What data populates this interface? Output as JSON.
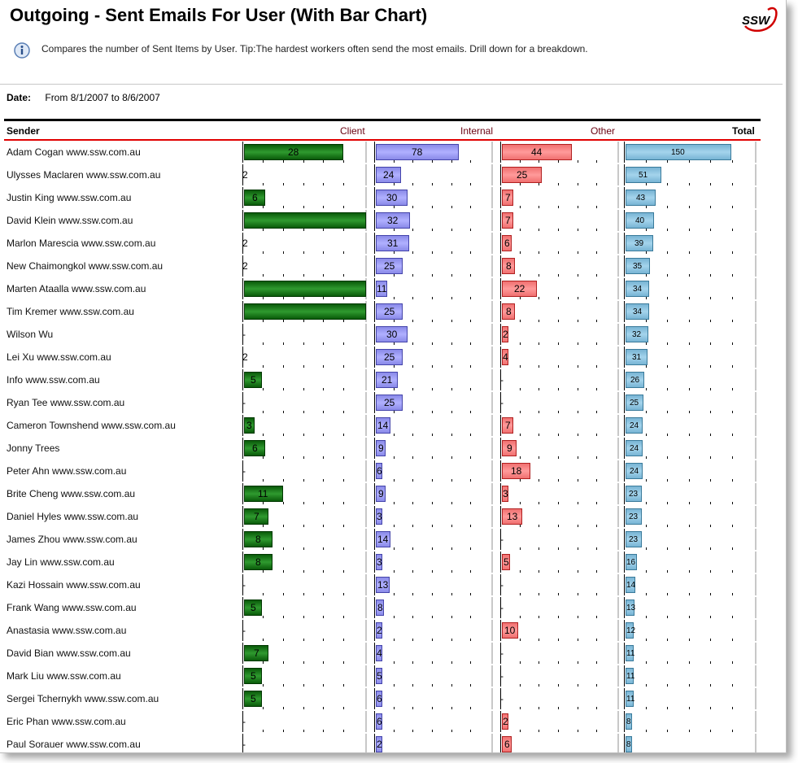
{
  "header": {
    "title": "Outgoing - Sent Emails For User (With Bar Chart)",
    "logo_text": "SSW",
    "description": "Compares the number of Sent Items by User. Tip:The hardest workers often send the most emails. Drill down for a breakdown."
  },
  "date": {
    "label": "Date:",
    "value": "From 8/1/2007 to 8/6/2007"
  },
  "columns": {
    "sender": "Sender",
    "client": "Client",
    "internal": "Internal",
    "other": "Other",
    "total": "Total"
  },
  "colors": {
    "client": "#1f7a1f",
    "internal": "#9a9af5",
    "other": "#f58080",
    "total": "#8cc4e0",
    "header_rule": "#e00000"
  },
  "rows": [
    {
      "sender": "Adam Cogan www.ssw.com.au",
      "client": {
        "label": "28",
        "value": 28
      },
      "internal": {
        "label": "78",
        "value": 78
      },
      "other": {
        "label": "44",
        "value": 44
      },
      "total": {
        "label": "150",
        "value": 150
      }
    },
    {
      "sender": "Ulysses Maclaren www.ssw.com.au",
      "client": {
        "label": "2",
        "value": 0
      },
      "internal": {
        "label": "24",
        "value": 24
      },
      "other": {
        "label": "25",
        "value": 25
      },
      "total": {
        "label": "51",
        "value": 51
      }
    },
    {
      "sender": "Justin King www.ssw.com.au",
      "client": {
        "label": "6",
        "value": 6
      },
      "internal": {
        "label": "30",
        "value": 30
      },
      "other": {
        "label": "7",
        "value": 7
      },
      "total": {
        "label": "43",
        "value": 43
      }
    },
    {
      "sender": "David Klein www.ssw.com.au",
      "client": {
        "label": "",
        "value": 35
      },
      "internal": {
        "label": "32",
        "value": 32
      },
      "other": {
        "label": "7",
        "value": 7
      },
      "total": {
        "label": "40",
        "value": 40
      }
    },
    {
      "sender": "Marlon Marescia www.ssw.com.au",
      "client": {
        "label": "2",
        "value": 0
      },
      "internal": {
        "label": "31",
        "value": 31
      },
      "other": {
        "label": "6",
        "value": 6
      },
      "total": {
        "label": "39",
        "value": 39
      }
    },
    {
      "sender": "New Chaimongkol www.ssw.com.au",
      "client": {
        "label": "2",
        "value": 0
      },
      "internal": {
        "label": "25",
        "value": 25
      },
      "other": {
        "label": "8",
        "value": 8
      },
      "total": {
        "label": "35",
        "value": 35
      }
    },
    {
      "sender": "Marten Ataalla www.ssw.com.au",
      "client": {
        "label": "",
        "value": 35
      },
      "internal": {
        "label": "11",
        "value": 11
      },
      "other": {
        "label": "22",
        "value": 22
      },
      "total": {
        "label": "34",
        "value": 34
      }
    },
    {
      "sender": "Tim Kremer www.ssw.com.au",
      "client": {
        "label": "",
        "value": 35
      },
      "internal": {
        "label": "25",
        "value": 25
      },
      "other": {
        "label": "8",
        "value": 8
      },
      "total": {
        "label": "34",
        "value": 34
      }
    },
    {
      "sender": "Wilson Wu",
      "client": {
        "label": "-",
        "value": 0
      },
      "internal": {
        "label": "30",
        "value": 30
      },
      "other": {
        "label": "2",
        "value": 2
      },
      "total": {
        "label": "32",
        "value": 32
      }
    },
    {
      "sender": "Lei Xu www.ssw.com.au",
      "client": {
        "label": "2",
        "value": 0
      },
      "internal": {
        "label": "25",
        "value": 25
      },
      "other": {
        "label": "4",
        "value": 4
      },
      "total": {
        "label": "31",
        "value": 31
      }
    },
    {
      "sender": "Info www.ssw.com.au",
      "client": {
        "label": "5",
        "value": 5
      },
      "internal": {
        "label": "21",
        "value": 21
      },
      "other": {
        "label": "-",
        "value": 0
      },
      "total": {
        "label": "26",
        "value": 26
      }
    },
    {
      "sender": "Ryan Tee www.ssw.com.au",
      "client": {
        "label": "-",
        "value": 0
      },
      "internal": {
        "label": "25",
        "value": 25
      },
      "other": {
        "label": "-",
        "value": 0
      },
      "total": {
        "label": "25",
        "value": 25
      }
    },
    {
      "sender": "Cameron Townshend www.ssw.com.au",
      "client": {
        "label": "3",
        "value": 3
      },
      "internal": {
        "label": "14",
        "value": 14
      },
      "other": {
        "label": "7",
        "value": 7
      },
      "total": {
        "label": "24",
        "value": 24
      }
    },
    {
      "sender": "Jonny Trees",
      "client": {
        "label": "6",
        "value": 6
      },
      "internal": {
        "label": "9",
        "value": 9
      },
      "other": {
        "label": "9",
        "value": 9
      },
      "total": {
        "label": "24",
        "value": 24
      }
    },
    {
      "sender": "Peter Ahn www.ssw.com.au",
      "client": {
        "label": "-",
        "value": 0
      },
      "internal": {
        "label": "6",
        "value": 6
      },
      "other": {
        "label": "18",
        "value": 18
      },
      "total": {
        "label": "24",
        "value": 24
      }
    },
    {
      "sender": "Brite Cheng www.ssw.com.au",
      "client": {
        "label": "11",
        "value": 11
      },
      "internal": {
        "label": "9",
        "value": 9
      },
      "other": {
        "label": "3",
        "value": 3
      },
      "total": {
        "label": "23",
        "value": 23
      }
    },
    {
      "sender": "Daniel Hyles www.ssw.com.au",
      "client": {
        "label": "7",
        "value": 7
      },
      "internal": {
        "label": "3",
        "value": 3
      },
      "other": {
        "label": "13",
        "value": 13
      },
      "total": {
        "label": "23",
        "value": 23
      }
    },
    {
      "sender": "James Zhou www.ssw.com.au",
      "client": {
        "label": "8",
        "value": 8
      },
      "internal": {
        "label": "14",
        "value": 14
      },
      "other": {
        "label": "-",
        "value": 0
      },
      "total": {
        "label": "23",
        "value": 23
      }
    },
    {
      "sender": "Jay Lin www.ssw.com.au",
      "client": {
        "label": "8",
        "value": 8
      },
      "internal": {
        "label": "3",
        "value": 3
      },
      "other": {
        "label": "5",
        "value": 5
      },
      "total": {
        "label": "16",
        "value": 16
      }
    },
    {
      "sender": "Kazi Hossain www.ssw.com.au",
      "client": {
        "label": "-",
        "value": 0
      },
      "internal": {
        "label": "13",
        "value": 13
      },
      "other": {
        "label": "-",
        "value": 0
      },
      "total": {
        "label": "14",
        "value": 14
      }
    },
    {
      "sender": "Frank Wang www.ssw.com.au",
      "client": {
        "label": "5",
        "value": 5
      },
      "internal": {
        "label": "8",
        "value": 8
      },
      "other": {
        "label": "-",
        "value": 0
      },
      "total": {
        "label": "13",
        "value": 13
      }
    },
    {
      "sender": "Anastasia www.ssw.com.au",
      "client": {
        "label": "-",
        "value": 0
      },
      "internal": {
        "label": "2",
        "value": 2
      },
      "other": {
        "label": "10",
        "value": 10
      },
      "total": {
        "label": "12",
        "value": 12
      }
    },
    {
      "sender": "David Bian www.ssw.com.au",
      "client": {
        "label": "7",
        "value": 7
      },
      "internal": {
        "label": "4",
        "value": 4
      },
      "other": {
        "label": "-",
        "value": 0
      },
      "total": {
        "label": "11",
        "value": 11
      }
    },
    {
      "sender": "Mark Liu www.ssw.com.au",
      "client": {
        "label": "5",
        "value": 5
      },
      "internal": {
        "label": "5",
        "value": 5
      },
      "other": {
        "label": "-",
        "value": 0
      },
      "total": {
        "label": "11",
        "value": 11
      }
    },
    {
      "sender": "Sergei Tchernykh www.ssw.com.au",
      "client": {
        "label": "5",
        "value": 5
      },
      "internal": {
        "label": "6",
        "value": 6
      },
      "other": {
        "label": "-",
        "value": 0
      },
      "total": {
        "label": "11",
        "value": 11
      }
    },
    {
      "sender": "Eric Phan www.ssw.com.au",
      "client": {
        "label": "-",
        "value": 0
      },
      "internal": {
        "label": "6",
        "value": 6
      },
      "other": {
        "label": "2",
        "value": 2
      },
      "total": {
        "label": "8",
        "value": 8
      }
    },
    {
      "sender": "Paul Sorauer www.ssw.com.au",
      "client": {
        "label": "-",
        "value": 0
      },
      "internal": {
        "label": "2",
        "value": 2
      },
      "other": {
        "label": "6",
        "value": 6
      },
      "total": {
        "label": "8",
        "value": 8
      }
    }
  ]
}
